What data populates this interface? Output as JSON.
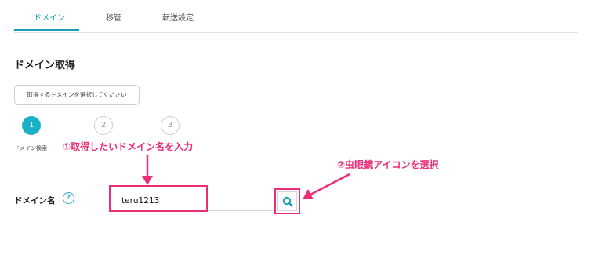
{
  "tabs": [
    {
      "label": "ドメイン",
      "active": true
    },
    {
      "label": "移管",
      "active": false
    },
    {
      "label": "転送設定",
      "active": false
    }
  ],
  "page_title": "ドメイン取得",
  "tooltip": "取得するドメインを選択してください",
  "steps": [
    {
      "number": "1",
      "caption": "ドメイン検索",
      "active": true
    },
    {
      "number": "2",
      "active": false
    },
    {
      "number": "3",
      "active": false
    }
  ],
  "annotations": {
    "step1": "①取得したいドメイン名を入力",
    "step2": "②虫眼鏡アイコンを選択"
  },
  "form": {
    "label": "ドメイン名",
    "help_icon": "?",
    "input_value": "teru1213"
  },
  "icons": {
    "search": "search-icon",
    "help": "question-circle-icon"
  },
  "colors": {
    "accent": "#1ab0c6",
    "annotation": "#ea2e78"
  }
}
